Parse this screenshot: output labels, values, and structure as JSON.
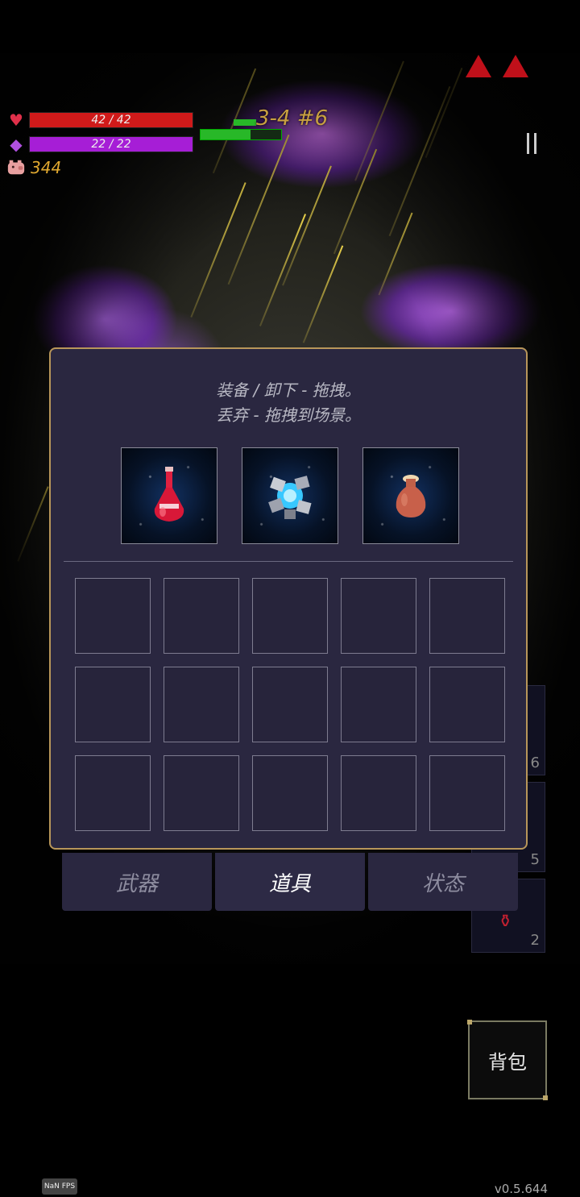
{
  "hud": {
    "hp_text": "42 / 42",
    "mp_text": "22 / 22",
    "coins": "344",
    "stage": "3-4 #6",
    "hp_fraction": 1.0,
    "mp_fraction": 1.0,
    "colors": {
      "hp": "#d01a1a",
      "mp": "#a61ed6",
      "coin": "#e0a830",
      "stage": "#c8a040"
    }
  },
  "inventory": {
    "instruction_line1": "装备 / 卸下 - 拖拽。",
    "instruction_line2": "丢弃 - 拖拽到场景。",
    "equipped": [
      {
        "icon": "red-potion-icon"
      },
      {
        "icon": "crystal-orb-icon"
      },
      {
        "icon": "clay-jar-icon"
      }
    ],
    "grid_rows": 3,
    "grid_cols": 5,
    "accent": "#b8965a"
  },
  "tabs": [
    {
      "label": "武器",
      "active": false
    },
    {
      "label": "道具",
      "active": true
    },
    {
      "label": "状态",
      "active": false
    }
  ],
  "side_numbers": [
    "6",
    "5",
    "2"
  ],
  "backpack_button_label": "背包",
  "fps_label": "NaN FPS",
  "version": "v0.5.644"
}
